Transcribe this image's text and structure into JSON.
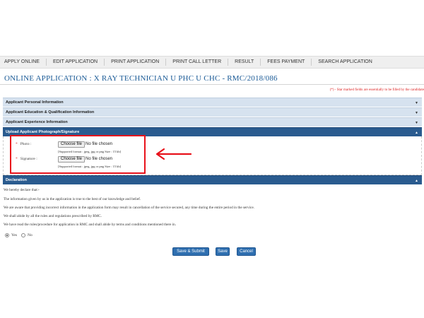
{
  "nav": {
    "items": [
      "APPLY ONLINE",
      "EDIT APPLICATION",
      "PRINT APPLICATION",
      "PRINT CALL LETTER",
      "RESULT",
      "FEES PAYMENT",
      "SEARCH APPLICATION"
    ]
  },
  "page": {
    "title": "ONLINE APPLICATION : X RAY TECHNICIAN U PHC U CHC - RMC/2018/086",
    "note": "(*) - Star marked fields are essentially to be filled by the candidate"
  },
  "sections": {
    "personal": "Applicant Personal Information",
    "education": "Applicant Education & Qualification Information",
    "experience": "Applicant Experience Information",
    "upload": "Upload Applicant Photograph/Signature",
    "declaration": "Declaration"
  },
  "upload": {
    "star": "*",
    "photo_label": "Photo :",
    "signature_label": "Signature :",
    "choose_label": "Choose file",
    "no_file": "No file chosen",
    "hint": "[Supported format : jpeg, jpg or png Size : 15 kb]"
  },
  "declaration": {
    "lines": [
      "We hereby declare that:-",
      "The information given by us in the application is true to the best of our knowledge and belief.",
      "We are aware that providing incorrect information in the application form may result in cancellation of the service secured, any time during the entire period in the service.",
      "We shall abide by all the rules and regulations prescribed by RMC.",
      "We have read the rules/procedure for application in RMC and shall abide by terms and conditions mentioned there in."
    ],
    "yes_label": "Yes",
    "no_label": "No",
    "selected": "Yes"
  },
  "buttons": {
    "save_submit": "Save & Submit",
    "save": "Save",
    "cancel": "Cancel"
  },
  "colors": {
    "accent": "#2a5b8f",
    "highlight": "#e8121b",
    "title": "#1a5a96"
  }
}
